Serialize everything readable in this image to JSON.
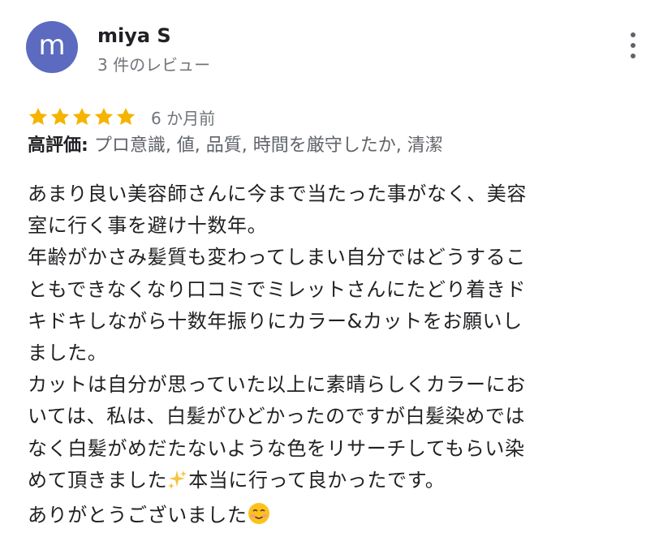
{
  "review": {
    "avatar_letter": "m",
    "author_name": "miya S",
    "review_count": "3 件のレビュー",
    "rating": 5,
    "rating_max": 5,
    "date": "6 か月前",
    "highlights_label": "高評価:",
    "highlights_value": "プロ意識, 値, 品質, 時間を厳守したか, 清潔",
    "body_lines": [
      "あまり良い美容師さんに今まで当たった事がなく、美容",
      "室に行く事を避け十数年。",
      "年齢がかさみ髪質も変わってしまい自分ではどうするこ",
      "ともできなくなり口コミでミレットさんにたどり着きド",
      "キドキしながら十数年振りにカラー&カットをお願いし",
      "ました。",
      "カットは自分が思っていた以上に素晴らしくカラーにお",
      "いては、私は、白髪がひどかったのですが白髪染めでは",
      "なく白髪がめだたないような色をリサーチしてもらい染",
      "めて頂きました",
      "本当に行って良かったです。",
      "ありがとうございました"
    ],
    "sparkles_emoji": "sparkles-icon",
    "smile_emoji": "smiling-face-icon"
  },
  "colors": {
    "avatar_bg": "#5c6bc0",
    "star": "#f4b400",
    "secondary_text": "#70757a"
  },
  "icons": {
    "more": "more-vert-icon",
    "star": "star-icon"
  }
}
